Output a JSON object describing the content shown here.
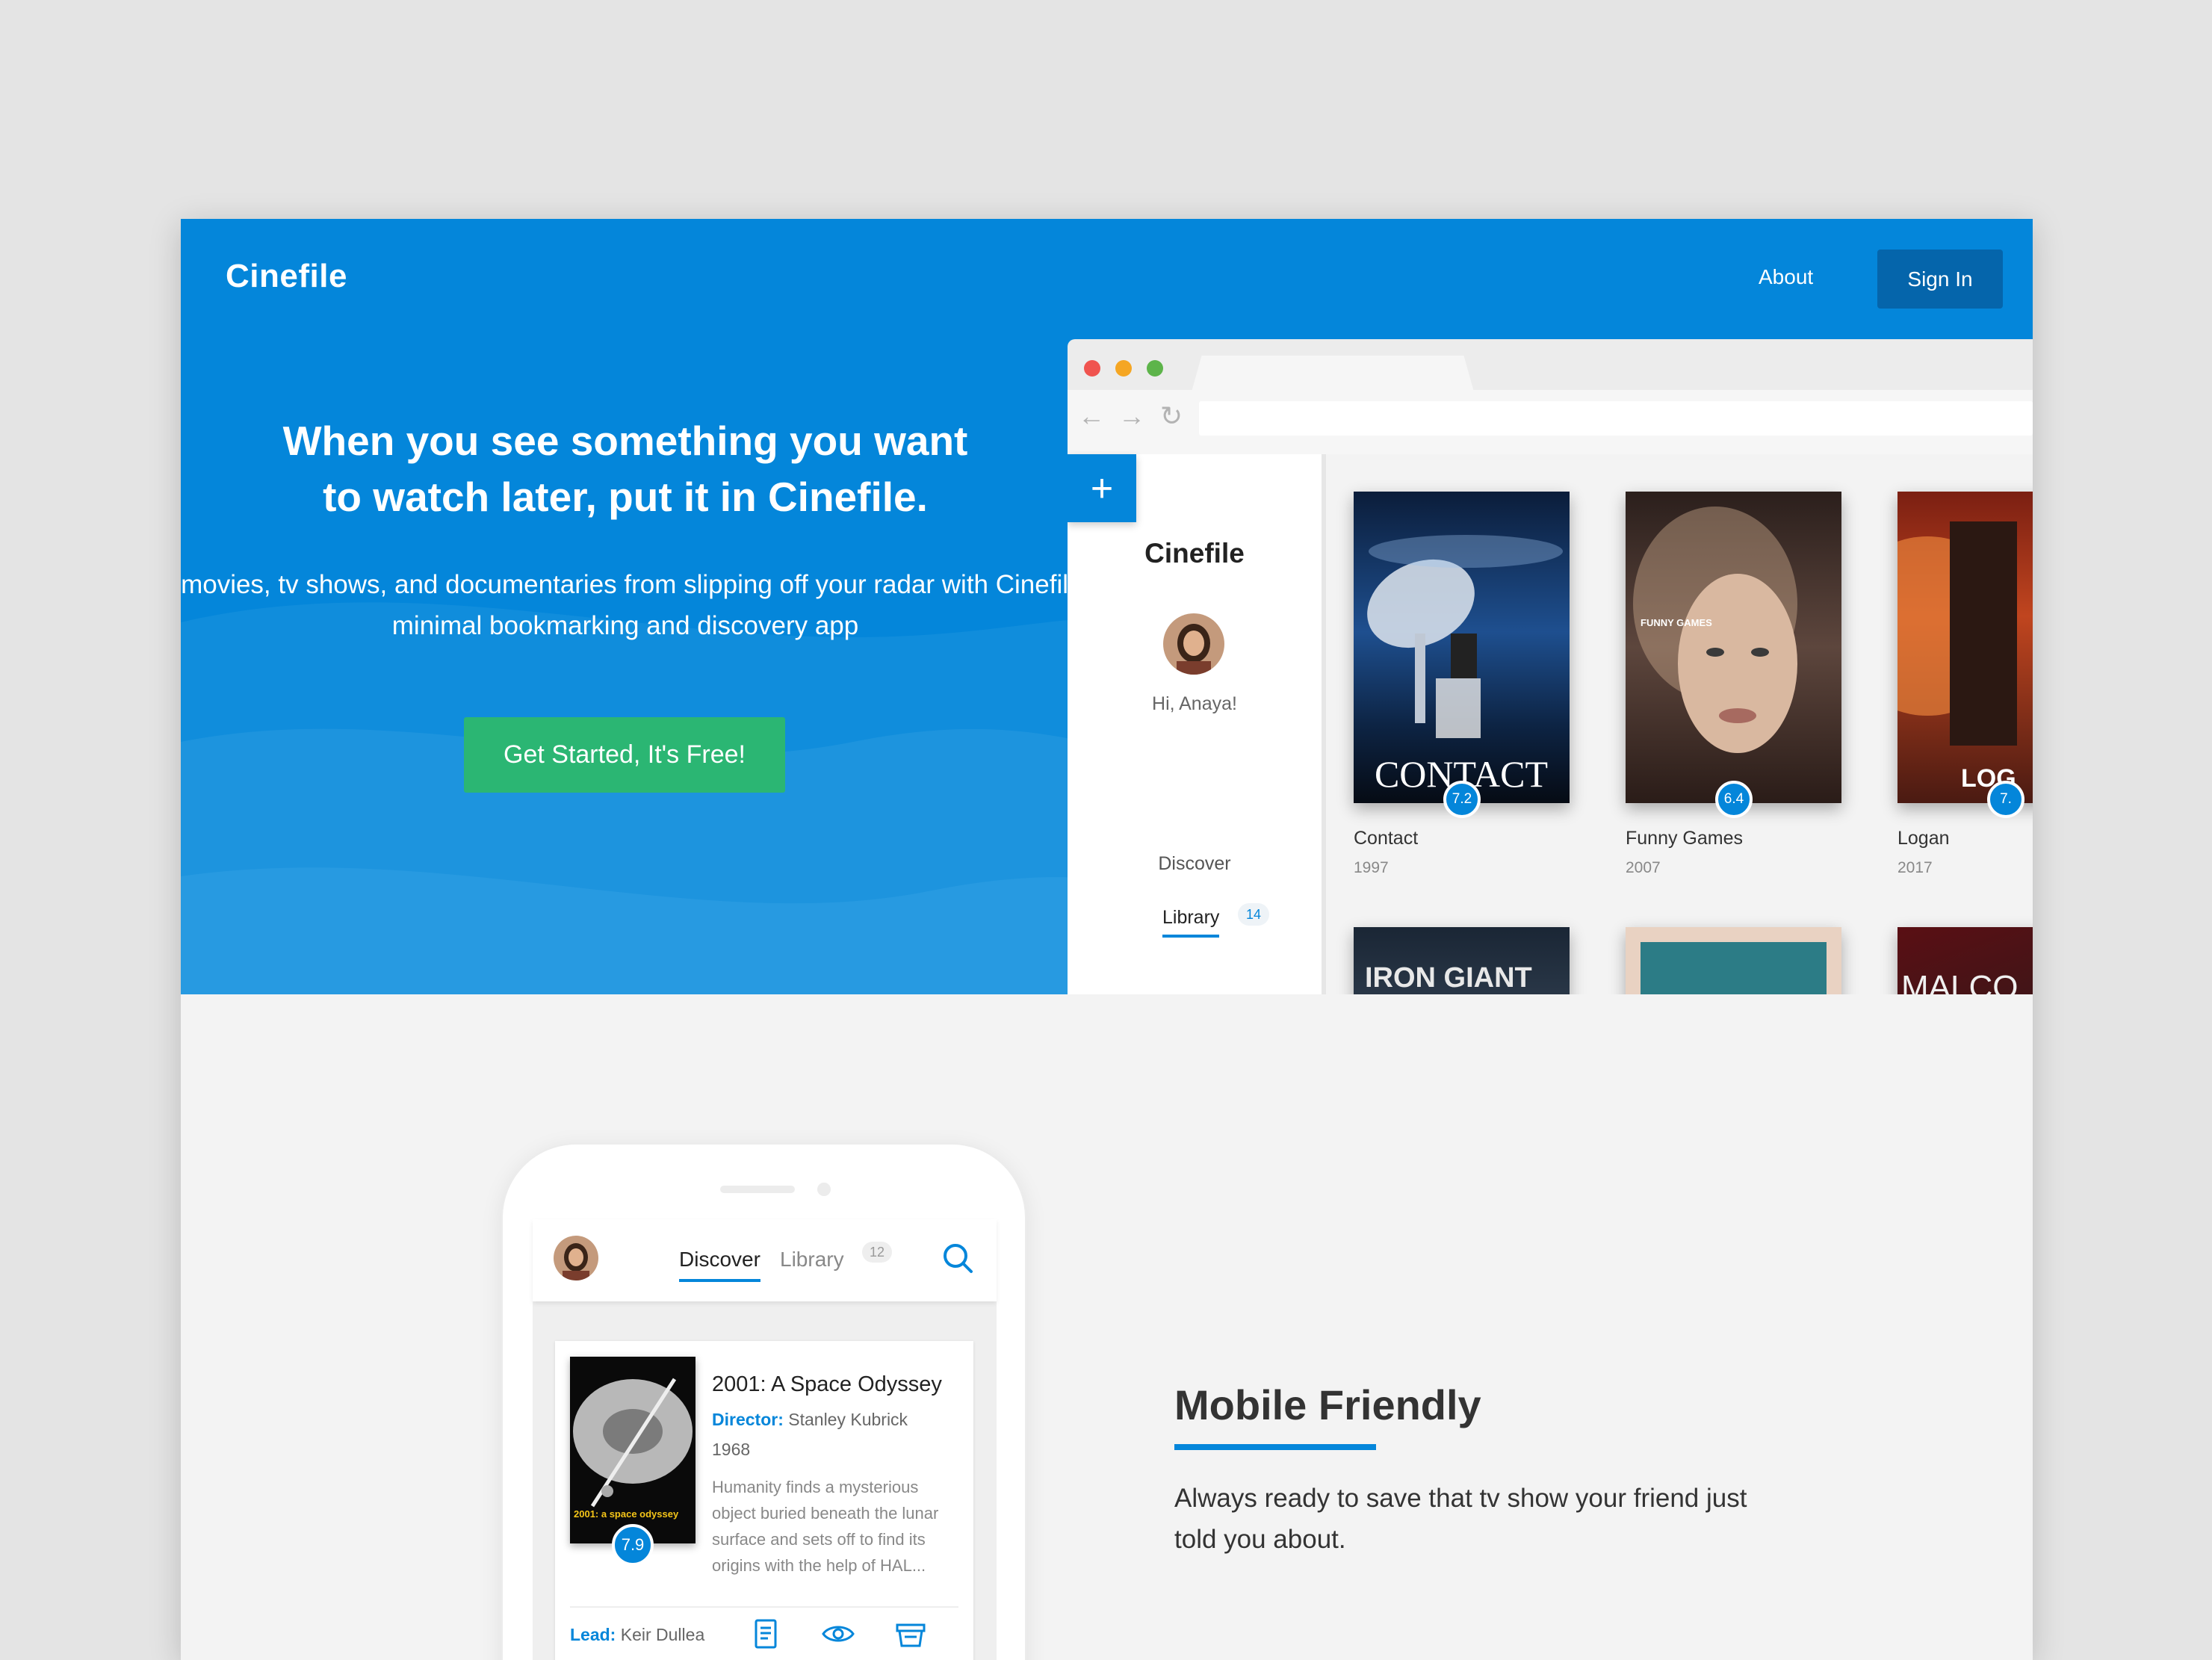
{
  "header": {
    "brand": "Cinefile",
    "nav_about": "About",
    "nav_signin": "Sign In"
  },
  "hero": {
    "title_line1": "When you see something you want",
    "title_line2": "to watch later, put it in Cinefile.",
    "subtitle": "Keep movies, tv shows, and documentaries from slipping off your radar with Cinefile — a minimal bookmarking and discovery app",
    "cta": "Get Started, It's Free!"
  },
  "browser_app": {
    "brand": "Cinefile",
    "greeting": "Hi, Anaya!",
    "nav_discover": "Discover",
    "nav_library": "Library",
    "library_count": "14",
    "add_icon": "plus-icon",
    "movies": [
      {
        "title": "Contact",
        "year": "1997",
        "rating": "7.2",
        "poster_text": "CONTACT"
      },
      {
        "title": "Funny Games",
        "year": "2007",
        "rating": "6.4",
        "poster_text": "FUNNY GAMES"
      },
      {
        "title": "Logan",
        "year": "2017",
        "rating": "7.",
        "poster_text": "LOG"
      }
    ],
    "second_row": [
      "IRON GIANT",
      "",
      "MALCO"
    ]
  },
  "mobile": {
    "tab_discover": "Discover",
    "tab_library": "Library",
    "library_count": "12",
    "search_icon": "search-icon",
    "card": {
      "title": "2001: A Space Odyssey",
      "director_label": "Director:",
      "director": "Stanley Kubrick",
      "year": "1968",
      "rating": "7.9",
      "poster_text": "2001: a space odyssey",
      "description": "Humanity finds a mysterious object buried beneath the lunar surface and sets off to find its origins with the help of HAL...",
      "lead_label": "Lead:",
      "lead": "Keir Dullea"
    }
  },
  "feature": {
    "title": "Mobile Friendly",
    "text": "Always ready to save that tv show your friend just told you about."
  },
  "colors": {
    "primary": "#0486da",
    "dark_primary": "#0565ab",
    "cta": "#2bb673",
    "background": "#f3f3f3"
  }
}
